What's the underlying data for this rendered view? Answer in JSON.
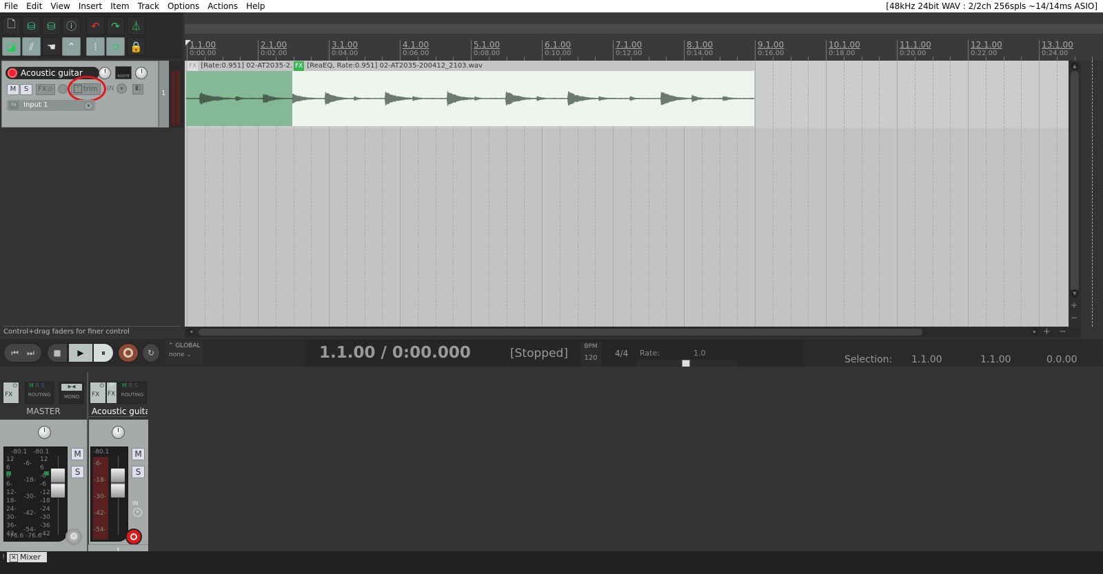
{
  "menu": {
    "items": [
      "File",
      "Edit",
      "View",
      "Insert",
      "Item",
      "Track",
      "Options",
      "Actions",
      "Help"
    ],
    "audio_status": "[48kHz 24bit WAV : 2/2ch 256spls ~14/14ms ASIO]"
  },
  "toolbar": {
    "row1": [
      "new-project",
      "open-project",
      "save-project",
      "project-settings",
      "undo",
      "redo",
      "metronome"
    ],
    "row2": [
      "auto-crossfade",
      "ripple-edit",
      "item-grouping",
      "envelope-points",
      "snap-grid",
      "loop",
      "lock"
    ]
  },
  "ruler": {
    "markers": [
      {
        "bar": "1.1.00",
        "time": "0:00.00"
      },
      {
        "bar": "2.1.00",
        "time": "0:02.00"
      },
      {
        "bar": "3.1.00",
        "time": "0:04.00"
      },
      {
        "bar": "4.1.00",
        "time": "0:06.00"
      },
      {
        "bar": "5.1.00",
        "time": "0:08.00"
      },
      {
        "bar": "6.1.00",
        "time": "0:10.00"
      },
      {
        "bar": "7.1.00",
        "time": "0:12.00"
      },
      {
        "bar": "8.1.00",
        "time": "0:14.00"
      },
      {
        "bar": "9.1.00",
        "time": "0:16.00"
      },
      {
        "bar": "10.1.00",
        "time": "0:18.00"
      },
      {
        "bar": "11.1.00",
        "time": "0:20.00"
      },
      {
        "bar": "12.1.00",
        "time": "0:22.00"
      },
      {
        "bar": "13.1.00",
        "time": "0:24.00"
      }
    ]
  },
  "track": {
    "name": "Acoustic guitar",
    "number": "1",
    "mute": "M",
    "solo": "S",
    "fx": "FX",
    "trim": "trim",
    "in": "IN",
    "route": "ROUTE",
    "input": "Input 1"
  },
  "items": [
    {
      "fx_label": "FX",
      "title": "[Rate:0.951] 02-AT2035-2...",
      "color": "#85b896"
    },
    {
      "fx_label": "FX",
      "title": "[ReaEQ, Rate:0.951] 02-AT2035-200412_2103.wav",
      "color": "#eef5ef"
    }
  ],
  "hint": "Control+drag faders for finer control",
  "transport": {
    "automation_mode": "GLOBAL",
    "automation_value": "none",
    "position": "1.1.00 / 0:00.000",
    "state": "[Stopped]",
    "bpm_label": "BPM",
    "bpm": "120",
    "time_sig": "4/4",
    "rate_label": "Rate:",
    "rate": "1.0",
    "selection_label": "Selection:",
    "sel_start": "1.1.00",
    "sel_end": "1.1.00",
    "sel_length": "0.0.00"
  },
  "mixer": {
    "master": {
      "name": "MASTER",
      "fx": "FX",
      "routing": "ROUTING",
      "mono": "MONO",
      "peak_l": "-80.1",
      "peak_r": "-80.1",
      "min_l": "-76.6",
      "min_r": "-76.6",
      "mute": "M",
      "solo": "S",
      "scale_left": [
        "12",
        "6",
        "0",
        "6-",
        "12-",
        "18-",
        "24-",
        "30-",
        "36-",
        "42-"
      ],
      "scale_mid": [
        "-6-",
        "-18-",
        "-30-",
        "-42-",
        "-54-"
      ],
      "scale_right": [
        "12",
        "6",
        "-0",
        "-6",
        "-12",
        "-18",
        "-24",
        "-30",
        "-36",
        "-42"
      ]
    },
    "track1": {
      "name": "Acoustic guita",
      "fx": "FX",
      "in_fx": "FX",
      "routing": "ROUTING",
      "peak": "-80.1",
      "mute": "M",
      "solo": "S",
      "in": "IN",
      "number": "1",
      "scale": [
        "-6-",
        "-18-",
        "-30-",
        "-42-",
        "-54-"
      ]
    },
    "tab_label": "Mixer"
  }
}
